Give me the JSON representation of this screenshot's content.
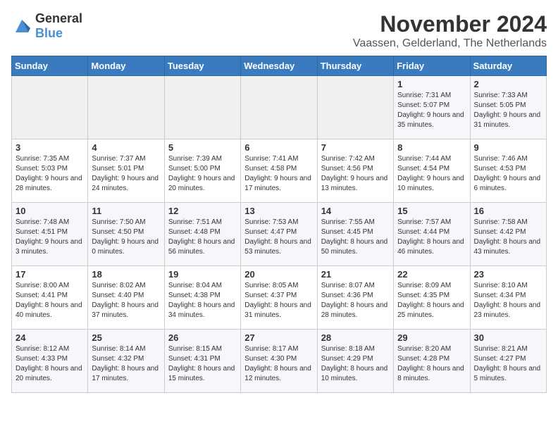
{
  "header": {
    "logo_general": "General",
    "logo_blue": "Blue",
    "month_title": "November 2024",
    "subtitle": "Vaassen, Gelderland, The Netherlands"
  },
  "weekdays": [
    "Sunday",
    "Monday",
    "Tuesday",
    "Wednesday",
    "Thursday",
    "Friday",
    "Saturday"
  ],
  "weeks": [
    [
      {
        "day": "",
        "info": ""
      },
      {
        "day": "",
        "info": ""
      },
      {
        "day": "",
        "info": ""
      },
      {
        "day": "",
        "info": ""
      },
      {
        "day": "",
        "info": ""
      },
      {
        "day": "1",
        "info": "Sunrise: 7:31 AM\nSunset: 5:07 PM\nDaylight: 9 hours and 35 minutes."
      },
      {
        "day": "2",
        "info": "Sunrise: 7:33 AM\nSunset: 5:05 PM\nDaylight: 9 hours and 31 minutes."
      }
    ],
    [
      {
        "day": "3",
        "info": "Sunrise: 7:35 AM\nSunset: 5:03 PM\nDaylight: 9 hours and 28 minutes."
      },
      {
        "day": "4",
        "info": "Sunrise: 7:37 AM\nSunset: 5:01 PM\nDaylight: 9 hours and 24 minutes."
      },
      {
        "day": "5",
        "info": "Sunrise: 7:39 AM\nSunset: 5:00 PM\nDaylight: 9 hours and 20 minutes."
      },
      {
        "day": "6",
        "info": "Sunrise: 7:41 AM\nSunset: 4:58 PM\nDaylight: 9 hours and 17 minutes."
      },
      {
        "day": "7",
        "info": "Sunrise: 7:42 AM\nSunset: 4:56 PM\nDaylight: 9 hours and 13 minutes."
      },
      {
        "day": "8",
        "info": "Sunrise: 7:44 AM\nSunset: 4:54 PM\nDaylight: 9 hours and 10 minutes."
      },
      {
        "day": "9",
        "info": "Sunrise: 7:46 AM\nSunset: 4:53 PM\nDaylight: 9 hours and 6 minutes."
      }
    ],
    [
      {
        "day": "10",
        "info": "Sunrise: 7:48 AM\nSunset: 4:51 PM\nDaylight: 9 hours and 3 minutes."
      },
      {
        "day": "11",
        "info": "Sunrise: 7:50 AM\nSunset: 4:50 PM\nDaylight: 9 hours and 0 minutes."
      },
      {
        "day": "12",
        "info": "Sunrise: 7:51 AM\nSunset: 4:48 PM\nDaylight: 8 hours and 56 minutes."
      },
      {
        "day": "13",
        "info": "Sunrise: 7:53 AM\nSunset: 4:47 PM\nDaylight: 8 hours and 53 minutes."
      },
      {
        "day": "14",
        "info": "Sunrise: 7:55 AM\nSunset: 4:45 PM\nDaylight: 8 hours and 50 minutes."
      },
      {
        "day": "15",
        "info": "Sunrise: 7:57 AM\nSunset: 4:44 PM\nDaylight: 8 hours and 46 minutes."
      },
      {
        "day": "16",
        "info": "Sunrise: 7:58 AM\nSunset: 4:42 PM\nDaylight: 8 hours and 43 minutes."
      }
    ],
    [
      {
        "day": "17",
        "info": "Sunrise: 8:00 AM\nSunset: 4:41 PM\nDaylight: 8 hours and 40 minutes."
      },
      {
        "day": "18",
        "info": "Sunrise: 8:02 AM\nSunset: 4:40 PM\nDaylight: 8 hours and 37 minutes."
      },
      {
        "day": "19",
        "info": "Sunrise: 8:04 AM\nSunset: 4:38 PM\nDaylight: 8 hours and 34 minutes."
      },
      {
        "day": "20",
        "info": "Sunrise: 8:05 AM\nSunset: 4:37 PM\nDaylight: 8 hours and 31 minutes."
      },
      {
        "day": "21",
        "info": "Sunrise: 8:07 AM\nSunset: 4:36 PM\nDaylight: 8 hours and 28 minutes."
      },
      {
        "day": "22",
        "info": "Sunrise: 8:09 AM\nSunset: 4:35 PM\nDaylight: 8 hours and 25 minutes."
      },
      {
        "day": "23",
        "info": "Sunrise: 8:10 AM\nSunset: 4:34 PM\nDaylight: 8 hours and 23 minutes."
      }
    ],
    [
      {
        "day": "24",
        "info": "Sunrise: 8:12 AM\nSunset: 4:33 PM\nDaylight: 8 hours and 20 minutes."
      },
      {
        "day": "25",
        "info": "Sunrise: 8:14 AM\nSunset: 4:32 PM\nDaylight: 8 hours and 17 minutes."
      },
      {
        "day": "26",
        "info": "Sunrise: 8:15 AM\nSunset: 4:31 PM\nDaylight: 8 hours and 15 minutes."
      },
      {
        "day": "27",
        "info": "Sunrise: 8:17 AM\nSunset: 4:30 PM\nDaylight: 8 hours and 12 minutes."
      },
      {
        "day": "28",
        "info": "Sunrise: 8:18 AM\nSunset: 4:29 PM\nDaylight: 8 hours and 10 minutes."
      },
      {
        "day": "29",
        "info": "Sunrise: 8:20 AM\nSunset: 4:28 PM\nDaylight: 8 hours and 8 minutes."
      },
      {
        "day": "30",
        "info": "Sunrise: 8:21 AM\nSunset: 4:27 PM\nDaylight: 8 hours and 5 minutes."
      }
    ]
  ]
}
